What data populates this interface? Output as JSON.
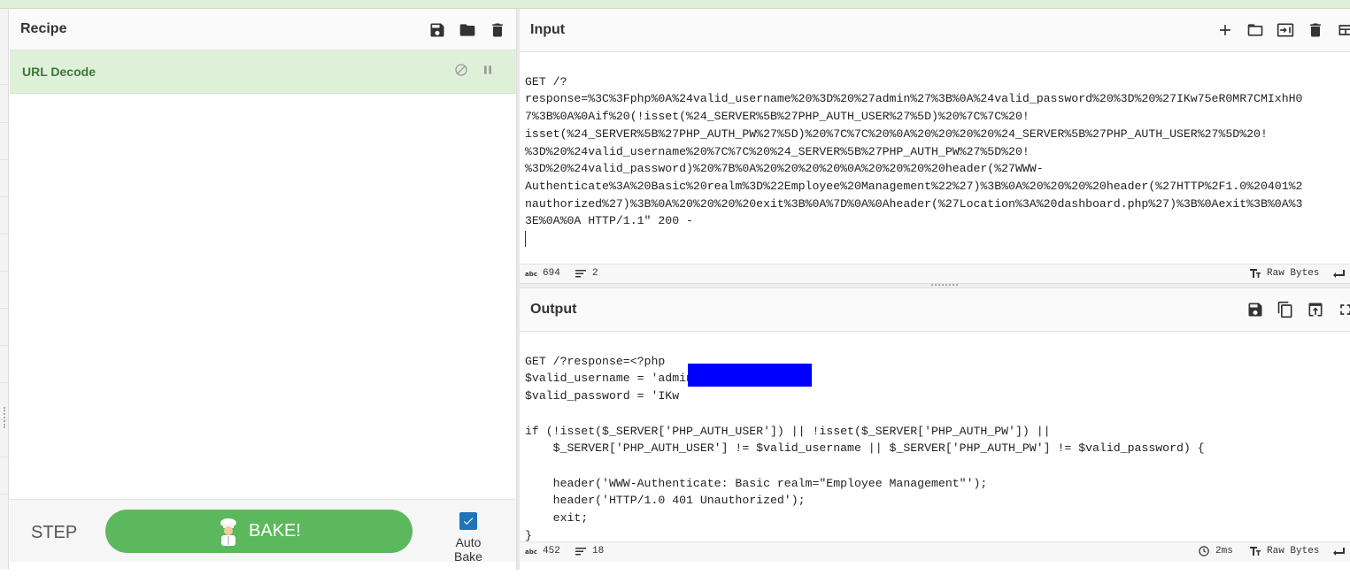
{
  "recipe": {
    "title": "Recipe",
    "operation": "URL Decode"
  },
  "bake_bar": {
    "step_label": "STEP",
    "bake_label": "BAKE!",
    "autobake_label": "Auto Bake",
    "autobake_checked": true
  },
  "input": {
    "title": "Input",
    "lines": [
      "GET /?",
      "response=%3C%3Fphp%0A%24valid_username%20%3D%20%27admin%27%3B%0A%24valid_password%20%3D%20%27IKw75eR0MR7CMIxhH0",
      "7%3B%0A%0Aif%20(!isset(%24_SERVER%5B%27PHP_AUTH_USER%27%5D)%20%7C%7C%20!",
      "isset(%24_SERVER%5B%27PHP_AUTH_PW%27%5D)%20%7C%7C%20%0A%20%20%20%20%24_SERVER%5B%27PHP_AUTH_USER%27%5D%20!",
      "%3D%20%24valid_username%20%7C%7C%20%24_SERVER%5B%27PHP_AUTH_PW%27%5D%20!",
      "%3D%20%24valid_password)%20%7B%0A%20%20%20%20%0A%20%20%20%20header(%27WWW-",
      "Authenticate%3A%20Basic%20realm%3D%22Employee%20Management%22%27)%3B%0A%20%20%20%20header(%27HTTP%2F1.0%20401%2",
      "nauthorized%27)%3B%0A%20%20%20%20exit%3B%0A%7D%0A%0Aheader(%27Location%3A%20dashboard.php%27)%3B%0Aexit%3B%0A%3",
      "3E%0A%0A HTTP/1.1\" 200 -"
    ],
    "status": {
      "chars": "694",
      "lines": "2",
      "encoding": "Raw Bytes"
    }
  },
  "output": {
    "title": "Output",
    "lines": [
      "GET /?response=<?php",
      "$valid_username = 'admin';",
      "$valid_password = 'IKw",
      "",
      "if (!isset($_SERVER['PHP_AUTH_USER']) || !isset($_SERVER['PHP_AUTH_PW']) ||",
      "    $_SERVER['PHP_AUTH_USER'] != $valid_username || $_SERVER['PHP_AUTH_PW'] != $valid_password) {",
      "",
      "    header('WWW-Authenticate: Basic realm=\"Employee Management\"');",
      "    header('HTTP/1.0 401 Unauthorized');",
      "    exit;",
      "}"
    ],
    "status": {
      "chars": "452",
      "lines": "18",
      "time": "2ms",
      "encoding": "Raw Bytes"
    }
  },
  "colors": {
    "accent_green": "#5cb85c",
    "operation_bg": "#dff0d8",
    "operation_text": "#3c763d",
    "redaction": "#0000ff",
    "checkbox": "#1f73b7"
  }
}
